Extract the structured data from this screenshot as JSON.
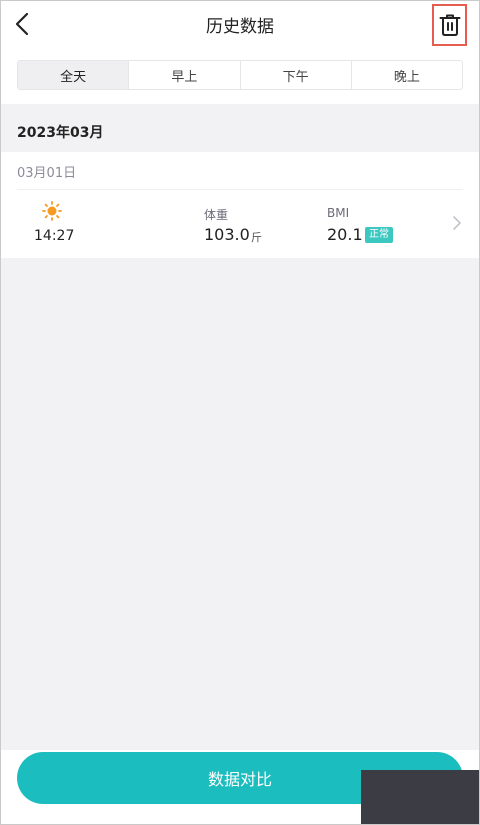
{
  "header": {
    "title": "历史数据",
    "back_icon": "chevron-left-icon",
    "delete_icon": "trash-icon",
    "highlight_color": "#e55d4e"
  },
  "tabs": [
    {
      "label": "全天",
      "active": true
    },
    {
      "label": "早上",
      "active": false
    },
    {
      "label": "下午",
      "active": false
    },
    {
      "label": "晚上",
      "active": false
    }
  ],
  "history": {
    "month": "2023年03月",
    "day": "03月01日",
    "record": {
      "time_icon": "sun-icon",
      "time": "14:27",
      "weight_label": "体重",
      "weight_value": "103.0",
      "weight_unit": "斤",
      "bmi_label": "BMI",
      "bmi_value": "20.1",
      "bmi_status": "正常",
      "status_color": "#3cc7c0"
    }
  },
  "footer": {
    "compare_label": "数据对比",
    "accent_color": "#1cbdbf"
  }
}
